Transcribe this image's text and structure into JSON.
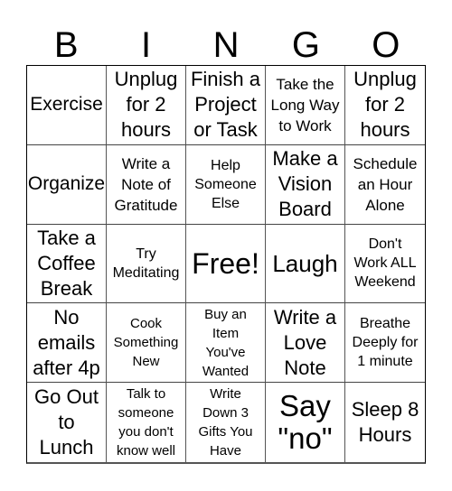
{
  "header": [
    "B",
    "I",
    "N",
    "G",
    "O"
  ],
  "cells": [
    "Exercise",
    "Unplug\nfor 2\nhours",
    "Finish a\nProject\nor Task",
    "Take the\nLong Way\nto Work",
    "Unplug\nfor 2\nhours",
    "Organize",
    "Write a\nNote of\nGratitude",
    "Help\nSomeone\nElse",
    "Make a\nVision\nBoard",
    "Schedule\nan Hour\nAlone",
    "Take a\nCoffee\nBreak",
    "Try\nMeditating",
    "Free!",
    "Laugh",
    "Don't\nWork ALL\nWeekend",
    "No\nemails\nafter 4p",
    "Cook\nSomething\nNew",
    "Buy an\nItem\nYou've\nWanted",
    "Write a\nLove\nNote",
    "Breathe\nDeeply for\n1 minute",
    "Go Out\nto\nLunch",
    "Talk to\nsomeone\nyou don't\nknow well",
    "Write\nDown 3\nGifts You\nHave",
    "Say\n\"no\"",
    "Sleep 8\nHours"
  ]
}
